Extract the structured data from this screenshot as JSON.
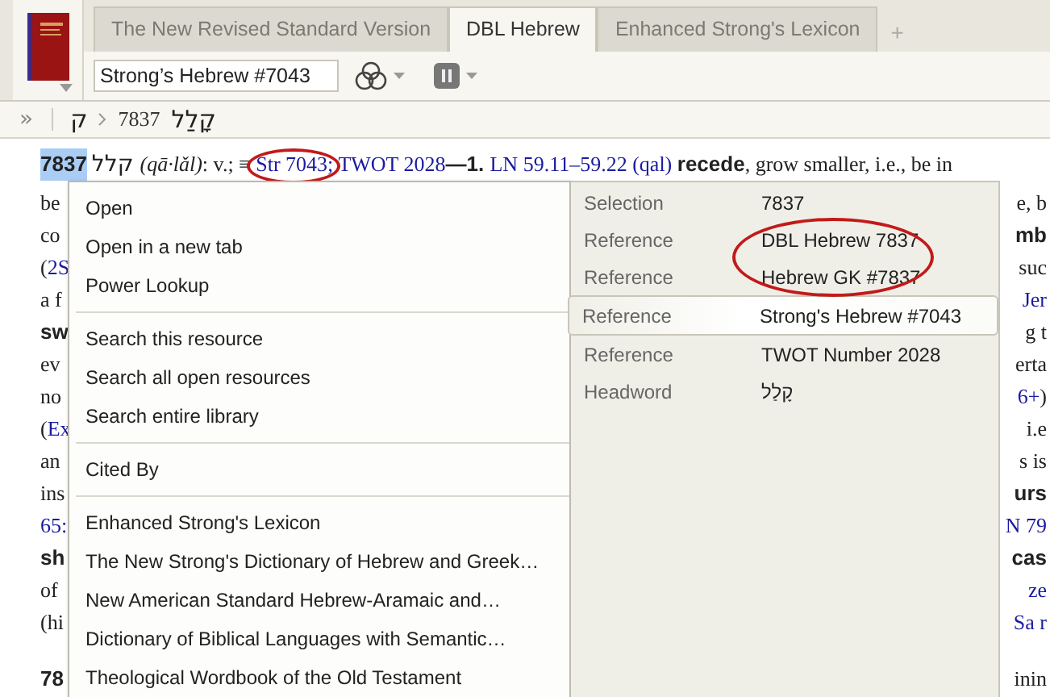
{
  "tabs": [
    {
      "label": "The New Revised Standard Version",
      "selected": false
    },
    {
      "label": "DBL Hebrew",
      "selected": true
    },
    {
      "label": "Enhanced Strong's Lexicon",
      "selected": false
    }
  ],
  "add_tab": "+",
  "reference_field": {
    "value": "Strong’s Hebrew #7043"
  },
  "breadcrumb": {
    "expand": "»",
    "root": "ק",
    "number": "7837",
    "headword": "קָלַל"
  },
  "entry": {
    "first_line": [
      {
        "text": "7837",
        "kind": "number",
        "circled": false
      },
      {
        "text": "קלל",
        "kind": "hebrew",
        "circled": false
      },
      {
        "text": "(qā·lǎl)",
        "kind": "italic",
        "circled": false
      },
      {
        "text": ": v.; ≡ ",
        "kind": "plain",
        "circled": false
      },
      {
        "text": "Str 7043;",
        "kind": "link",
        "circled": true
      },
      {
        "text": " TWOT 2028",
        "kind": "link",
        "circled": false
      },
      {
        "text": "—1. ",
        "kind": "bold",
        "circled": false
      },
      {
        "text": "LN 59.11–59.22",
        "kind": "link",
        "circled": false
      },
      {
        "text": " (qal) ",
        "kind": "link",
        "circled": false
      },
      {
        "text": "recede",
        "kind": "bold",
        "circled": false
      },
      {
        "text": ", grow smaller, i.e., be in",
        "kind": "plain",
        "circled": false
      }
    ],
    "lines": [
      {
        "left": [
          {
            "text": "be",
            "kind": "plain"
          }
        ],
        "right": [
          {
            "text": "e, b",
            "kind": "plain"
          }
        ]
      },
      {
        "left": [
          {
            "text": "co",
            "kind": "plain"
          }
        ],
        "right": [
          {
            "text": "mb",
            "kind": "bold"
          }
        ]
      },
      {
        "left": [
          {
            "text": "(",
            "kind": "plain"
          },
          {
            "text": "2S",
            "kind": "link"
          }
        ],
        "right": [
          {
            "text": "suc",
            "kind": "plain"
          }
        ]
      },
      {
        "left": [
          {
            "text": "a f",
            "kind": "plain"
          }
        ],
        "right": [
          {
            "text": "Jer",
            "kind": "link"
          }
        ]
      },
      {
        "left": [
          {
            "text": "sw",
            "kind": "bold"
          }
        ],
        "right": [
          {
            "text": "g t",
            "kind": "plain"
          }
        ]
      },
      {
        "left": [
          {
            "text": "ev",
            "kind": "plain"
          }
        ],
        "right": [
          {
            "text": "erta",
            "kind": "plain"
          }
        ]
      },
      {
        "left": [
          {
            "text": "no",
            "kind": "plain"
          }
        ],
        "right": [
          {
            "text": "6+",
            "kind": "link"
          },
          {
            "text": ")",
            "kind": "plain"
          }
        ]
      },
      {
        "left": [
          {
            "text": "(",
            "kind": "plain"
          },
          {
            "text": "Ex",
            "kind": "link"
          }
        ],
        "right": [
          {
            "text": "i.e",
            "kind": "plain"
          }
        ]
      },
      {
        "left": [
          {
            "text": "an",
            "kind": "plain"
          }
        ],
        "right": [
          {
            "text": "s is",
            "kind": "plain"
          }
        ]
      },
      {
        "left": [
          {
            "text": "ins",
            "kind": "plain"
          }
        ],
        "right": [
          {
            "text": "urs",
            "kind": "bold"
          }
        ]
      },
      {
        "left": [
          {
            "text": "65:",
            "kind": "link"
          }
        ],
        "right": [
          {
            "text": "N 79",
            "kind": "link"
          }
        ]
      },
      {
        "left": [
          {
            "text": "sh",
            "kind": "bold"
          }
        ],
        "right": [
          {
            "text": "cas",
            "kind": "bold"
          }
        ]
      },
      {
        "left": [
          {
            "text": "of",
            "kind": "plain"
          }
        ],
        "right": [
          {
            "text": "ze",
            "kind": "link"
          }
        ]
      },
      {
        "left": [
          {
            "text": "(hi",
            "kind": "plain"
          }
        ],
        "right": [
          {
            "text": "Sa r",
            "kind": "link"
          }
        ]
      }
    ],
    "last_line": {
      "left": [
        {
          "text": "78",
          "kind": "bold"
        }
      ],
      "right": [
        {
          "text": "inin",
          "kind": "plain"
        }
      ]
    }
  },
  "context_menu": {
    "groups": [
      [
        "Open",
        "Open in a new tab",
        "Power Lookup"
      ],
      [
        "Search this resource",
        "Search all open resources",
        "Search entire library"
      ],
      [
        "Cited By"
      ],
      [
        "Enhanced Strong's Lexicon",
        "The New Strong's Dictionary of Hebrew and Greek…",
        "New American Standard Hebrew-Aramaic and…",
        "Dictionary of Biblical Languages with Semantic…",
        "Theological Wordbook of the Old Testament"
      ]
    ]
  },
  "info_panel": {
    "rows": [
      {
        "label": "Selection",
        "value": "7837",
        "selected": false,
        "circled": false
      },
      {
        "label": "Reference",
        "value": "DBL Hebrew 7837",
        "selected": false,
        "circled": true
      },
      {
        "label": "Reference",
        "value": "Hebrew GK #7837",
        "selected": false,
        "circled": true
      },
      {
        "label": "Reference",
        "value": "Strong's Hebrew #7043",
        "selected": true,
        "circled": false
      },
      {
        "label": "Reference",
        "value": "TWOT Number 2028",
        "selected": false,
        "circled": false
      },
      {
        "label": "Headword",
        "value": "קָלַל",
        "selected": false,
        "circled": false
      }
    ]
  }
}
